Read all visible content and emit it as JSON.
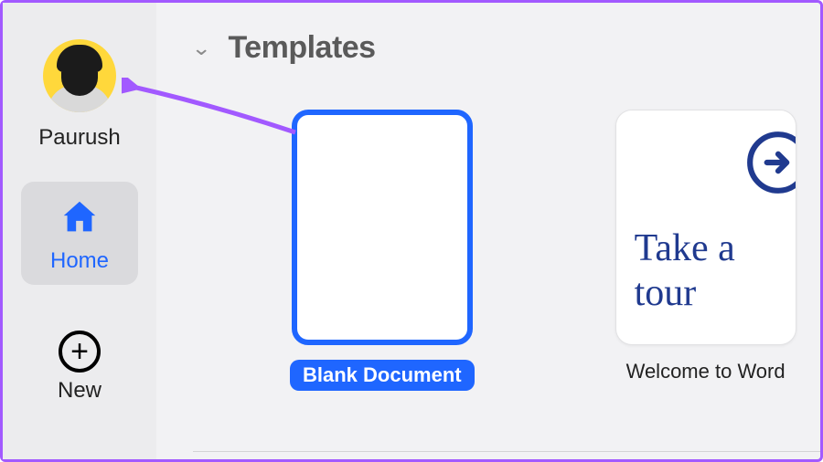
{
  "sidebar": {
    "username": "Paurush",
    "items": [
      {
        "id": "home",
        "label": "Home",
        "active": true
      },
      {
        "id": "new",
        "label": "New",
        "active": false
      }
    ]
  },
  "main": {
    "section_title": "Templates",
    "templates": [
      {
        "id": "blank",
        "label": "Blank Document",
        "selected": true,
        "preview_text": ""
      },
      {
        "id": "welcome",
        "label": "Welcome to Word",
        "selected": false,
        "preview_text": "Take a tour"
      }
    ]
  },
  "colors": {
    "accent": "#1f66ff",
    "frame_border": "#a259ff",
    "avatar_bg": "#ffd83b"
  }
}
